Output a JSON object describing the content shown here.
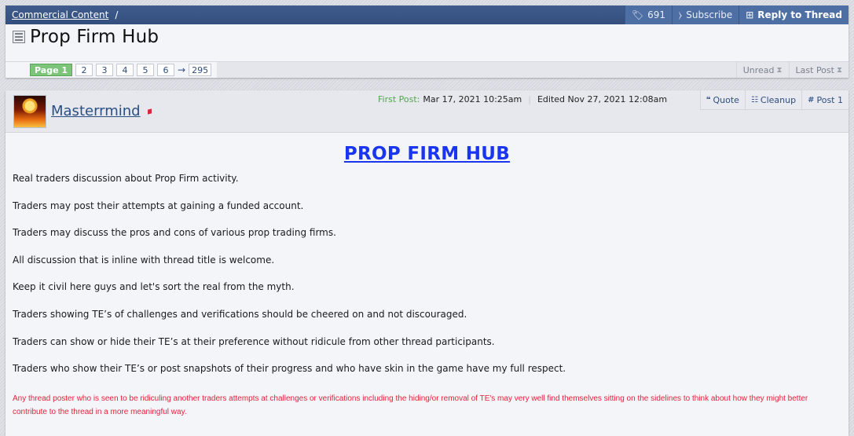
{
  "breadcrumb": {
    "link": "Commercial Content",
    "separator": "/"
  },
  "top_actions": {
    "tags_count": "691",
    "subscribe": "Subscribe",
    "reply": "Reply to Thread"
  },
  "thread": {
    "title": "Prop Firm Hub"
  },
  "pager": {
    "current": "Page 1",
    "pages": [
      "2",
      "3",
      "4",
      "5",
      "6"
    ],
    "arrow": "→",
    "last": "295"
  },
  "sort": {
    "unread": "Unread",
    "last_post": "Last Post"
  },
  "post": {
    "username": "Masterrmind",
    "first_post_label": "First Post:",
    "first_post_date": "Mar 17, 2021 10:25am",
    "separator": "|",
    "edited": "Edited Nov 27, 2021 12:08am",
    "actions": {
      "quote": "Quote",
      "cleanup": "Cleanup",
      "post_number": "Post 1"
    },
    "heading": "PROP FIRM HUB",
    "paragraphs": [
      "Real traders discussion about Prop Firm activity.",
      "Traders may post their attempts at gaining a funded account.",
      "Traders may discuss the pros and cons of various prop trading firms.",
      "All discussion that is inline with thread title is welcome.",
      "Keep it civil here guys and let's sort the real from the myth.",
      "Traders showing TE’s of challenges and verifications should be cheered on and not discouraged.",
      "Traders can show or hide their TE’s at their preference without ridicule from other thread participants.",
      "Traders who show their TE’s or post snapshots of their progress and who have skin in the game have my full respect."
    ],
    "warning": "Any thread poster who is seen to be ridiculing another traders attempts at challenges or verifications including the hiding/or removal of TE's may very well find themselves sitting on the sidelines to think about how they might better contribute to the thread in a more meaningful way."
  },
  "colors": {
    "header_bg": "#3a5686",
    "page_current": "#7bc47a",
    "heading_link": "#1a35f0",
    "warning_text": "#e8203a",
    "first_post_label": "#4fa84a"
  }
}
